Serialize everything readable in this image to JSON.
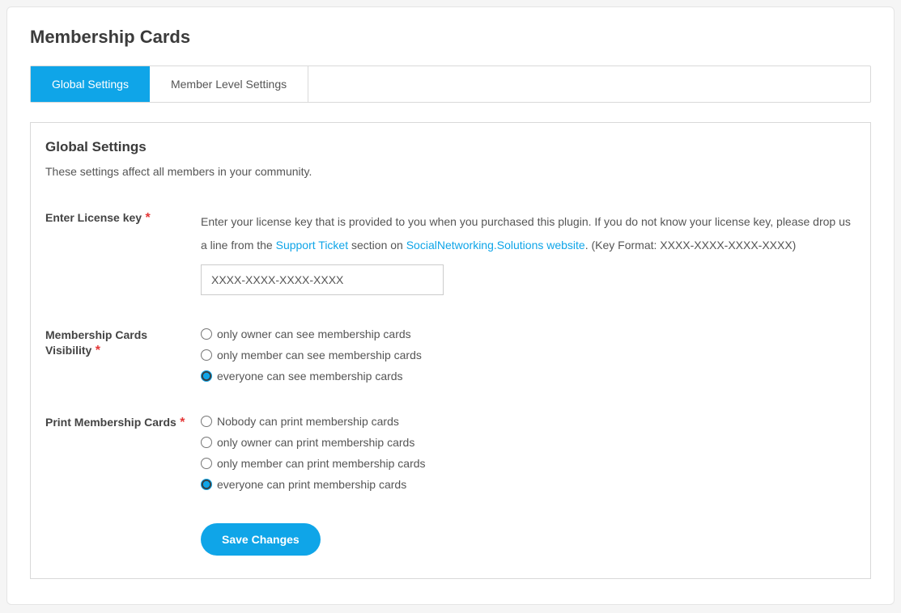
{
  "page": {
    "title": "Membership Cards"
  },
  "tabs": {
    "global": "Global Settings",
    "member_level": "Member Level Settings"
  },
  "box": {
    "heading": "Global Settings",
    "subtext": "These settings affect all members in your community."
  },
  "license": {
    "label": "Enter License key",
    "help_prefix": "Enter your license key that is provided to you when you purchased this plugin. If you do not know your license key, please drop us a line from the ",
    "link1": "Support Ticket",
    "help_mid": " section on ",
    "link2": "SocialNetworking.Solutions website",
    "help_suffix": ". (Key Format: XXXX-XXXX-XXXX-XXXX)",
    "value": "XXXX-XXXX-XXXX-XXXX"
  },
  "visibility": {
    "label": "Membership Cards Visibility",
    "options": {
      "owner": "only owner can see membership cards",
      "member": "only member can see membership cards",
      "everyone": "everyone can see membership cards"
    },
    "selected": "everyone"
  },
  "print": {
    "label": "Print Membership Cards",
    "options": {
      "nobody": "Nobody can print membership cards",
      "owner": "only owner can print membership cards",
      "member": "only member can print membership cards",
      "everyone": "everyone can print membership cards"
    },
    "selected": "everyone"
  },
  "buttons": {
    "save": "Save Changes"
  },
  "required_mark": "*"
}
